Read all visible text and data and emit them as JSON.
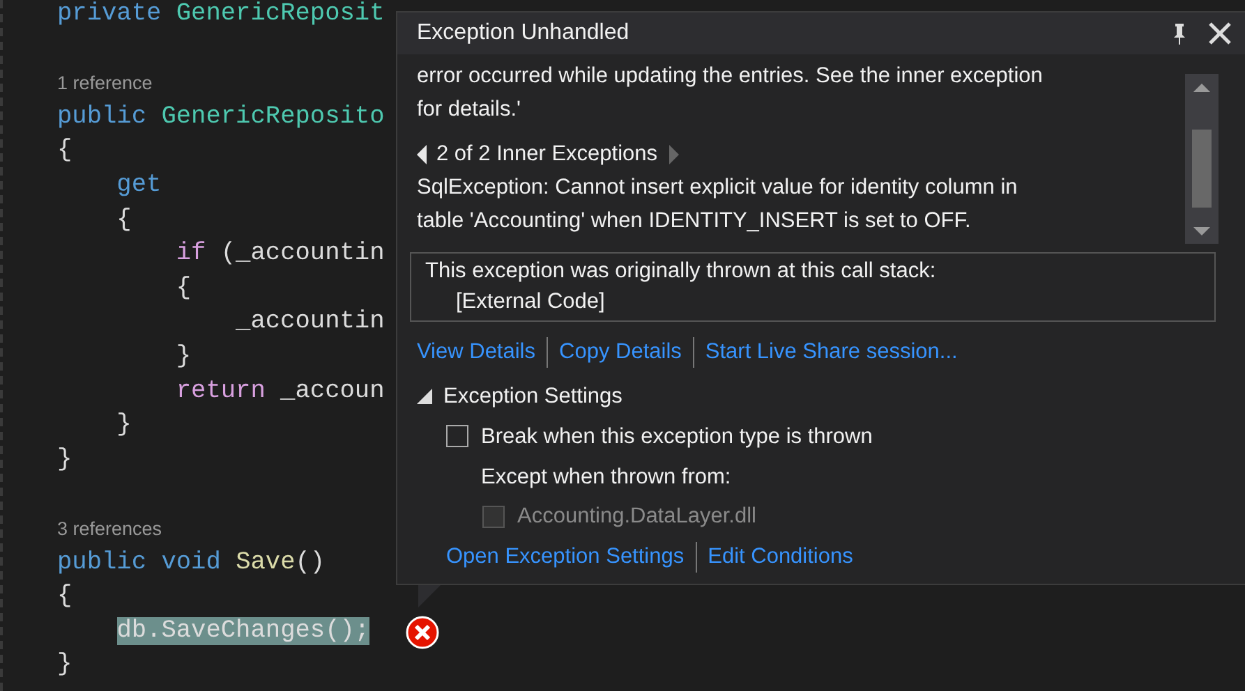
{
  "editor": {
    "lines": [
      {
        "kind": "code",
        "tokens": [
          {
            "text": "private ",
            "kind": "keyword"
          },
          {
            "text": "GenericReposit",
            "kind": "type"
          }
        ]
      },
      {
        "kind": "blank"
      },
      {
        "kind": "lens",
        "text": "1 reference"
      },
      {
        "kind": "code",
        "tokens": [
          {
            "text": "public ",
            "kind": "keyword"
          },
          {
            "text": "GenericReposito",
            "kind": "type"
          }
        ]
      },
      {
        "kind": "code",
        "tokens": [
          {
            "text": "{",
            "kind": "plain"
          }
        ]
      },
      {
        "kind": "code",
        "tokens": [
          {
            "text": "    get",
            "kind": "keyword"
          }
        ]
      },
      {
        "kind": "code",
        "tokens": [
          {
            "text": "    {",
            "kind": "plain"
          }
        ]
      },
      {
        "kind": "code",
        "tokens": [
          {
            "text": "        if",
            "kind": "control"
          },
          {
            "text": " (_accountin",
            "kind": "plain"
          }
        ]
      },
      {
        "kind": "code",
        "tokens": [
          {
            "text": "        {",
            "kind": "plain"
          }
        ]
      },
      {
        "kind": "code",
        "tokens": [
          {
            "text": "            _accountin",
            "kind": "plain"
          }
        ]
      },
      {
        "kind": "code",
        "tokens": [
          {
            "text": "        }",
            "kind": "plain"
          }
        ]
      },
      {
        "kind": "code",
        "tokens": [
          {
            "text": "        return",
            "kind": "control"
          },
          {
            "text": " _accoun",
            "kind": "plain"
          }
        ]
      },
      {
        "kind": "code",
        "tokens": [
          {
            "text": "    }",
            "kind": "plain"
          }
        ]
      },
      {
        "kind": "code",
        "tokens": [
          {
            "text": "}",
            "kind": "plain"
          }
        ]
      },
      {
        "kind": "blank"
      },
      {
        "kind": "lens",
        "text": "3 references"
      },
      {
        "kind": "code",
        "tokens": [
          {
            "text": "public ",
            "kind": "keyword"
          },
          {
            "text": "void ",
            "kind": "keyword"
          },
          {
            "text": "Save",
            "kind": "method"
          },
          {
            "text": "()",
            "kind": "plain"
          }
        ]
      },
      {
        "kind": "code",
        "tokens": [
          {
            "text": "{",
            "kind": "plain"
          }
        ]
      },
      {
        "kind": "code",
        "highlight": true,
        "tokens": [
          {
            "text": "    db.SaveChanges();",
            "kind": "plain"
          }
        ]
      },
      {
        "kind": "code",
        "tokens": [
          {
            "text": "}",
            "kind": "plain"
          }
        ]
      }
    ]
  },
  "popup": {
    "title": "Exception Unhandled",
    "message": "error occurred while updating the entries. See the inner exception\nfor details.'",
    "inner_nav": {
      "label": "2 of 2 Inner Exceptions",
      "previous_enabled": true,
      "next_enabled": false
    },
    "inner_message": "SqlException: Cannot insert explicit value for identity column in\ntable 'Accounting' when IDENTITY_INSERT is set to OFF.",
    "call_stack": {
      "heading": "This exception was originally thrown at this call stack:",
      "frames": [
        "[External Code]"
      ]
    },
    "links": [
      "View Details",
      "Copy Details",
      "Start Live Share session..."
    ],
    "settings": {
      "label": "Exception Settings",
      "expanded": true,
      "break_option": {
        "label": "Break when this exception type is thrown",
        "checked": false
      },
      "except_label": "Except when thrown from:",
      "modules": [
        {
          "label": "Accounting.DataLayer.dll",
          "checked": false,
          "disabled": true
        }
      ],
      "links": [
        "Open Exception Settings",
        "Edit Conditions"
      ]
    }
  }
}
